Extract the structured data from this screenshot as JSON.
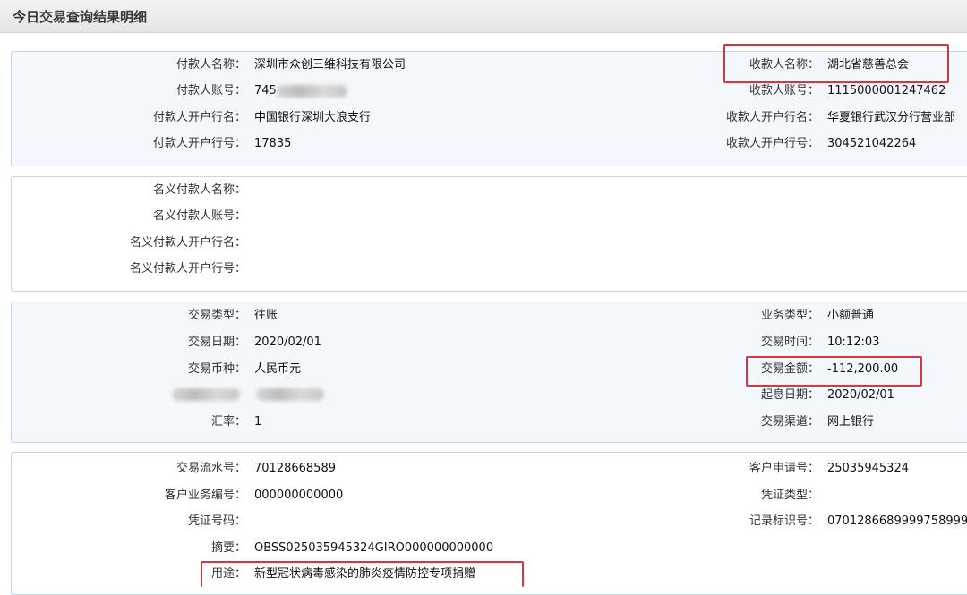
{
  "page": {
    "title": "今日交易查询结果明细"
  },
  "payer": {
    "name_label": "付款人名称：",
    "name": "深圳市众创三维科技有限公司",
    "account_label": "付款人账号：",
    "account": "745",
    "bank_label": "付款人开户行名：",
    "bank": "中国银行深圳大浪支行",
    "bank_no_label": "付款人开户行号：",
    "bank_no": "17835"
  },
  "payee": {
    "name_label": "收款人名称：",
    "name": "湖北省慈善总会",
    "account_label": "收款人账号：",
    "account": "1115000001247462",
    "bank_label": "收款人开户行名：",
    "bank": "华夏银行武汉分行营业部",
    "bank_no_label": "收款人开户行号：",
    "bank_no": "304521042264"
  },
  "nominal": {
    "name_label": "名义付款人名称：",
    "account_label": "名义付款人账号：",
    "bank_label": "名义付款人开户行名：",
    "bank_no_label": "名义付款人开户行号："
  },
  "transaction": {
    "type_label": "交易类型：",
    "type": "往账",
    "date_label": "交易日期：",
    "date": "2020/02/01",
    "currency_label": "交易币种：",
    "currency": "人民币元",
    "rate_label": "汇率：",
    "rate": "1",
    "biz_type_label": "业务类型：",
    "biz_type": "小额普通",
    "time_label": "交易时间：",
    "time": "10:12:03",
    "amount_label": "交易金额：",
    "amount": "-112,200.00",
    "value_date_label": "起息日期：",
    "value_date": "2020/02/01",
    "channel_label": "交易渠道：",
    "channel": "网上银行"
  },
  "details": {
    "serial_label": "交易流水号：",
    "serial": "70128668589",
    "biz_no_label": "客户业务编号：",
    "biz_no": "000000000000",
    "voucher_no_label": "凭证号码：",
    "summary_label": "摘要：",
    "summary": "OBSS025035945324GIRO000000000000",
    "purpose_label": "用途：",
    "purpose": "新型冠状病毒感染的肺炎疫情防控专项捐赠",
    "apply_no_label": "客户申请号：",
    "apply_no": "25035945324",
    "voucher_type_label": "凭证类型：",
    "record_id_label": "记录标识号：",
    "record_id": "0701286689999758999"
  },
  "colors": {
    "highlight": "#d7373f",
    "panel_border": "#c6d3e0",
    "panel_blue": "#f4f8fc"
  }
}
